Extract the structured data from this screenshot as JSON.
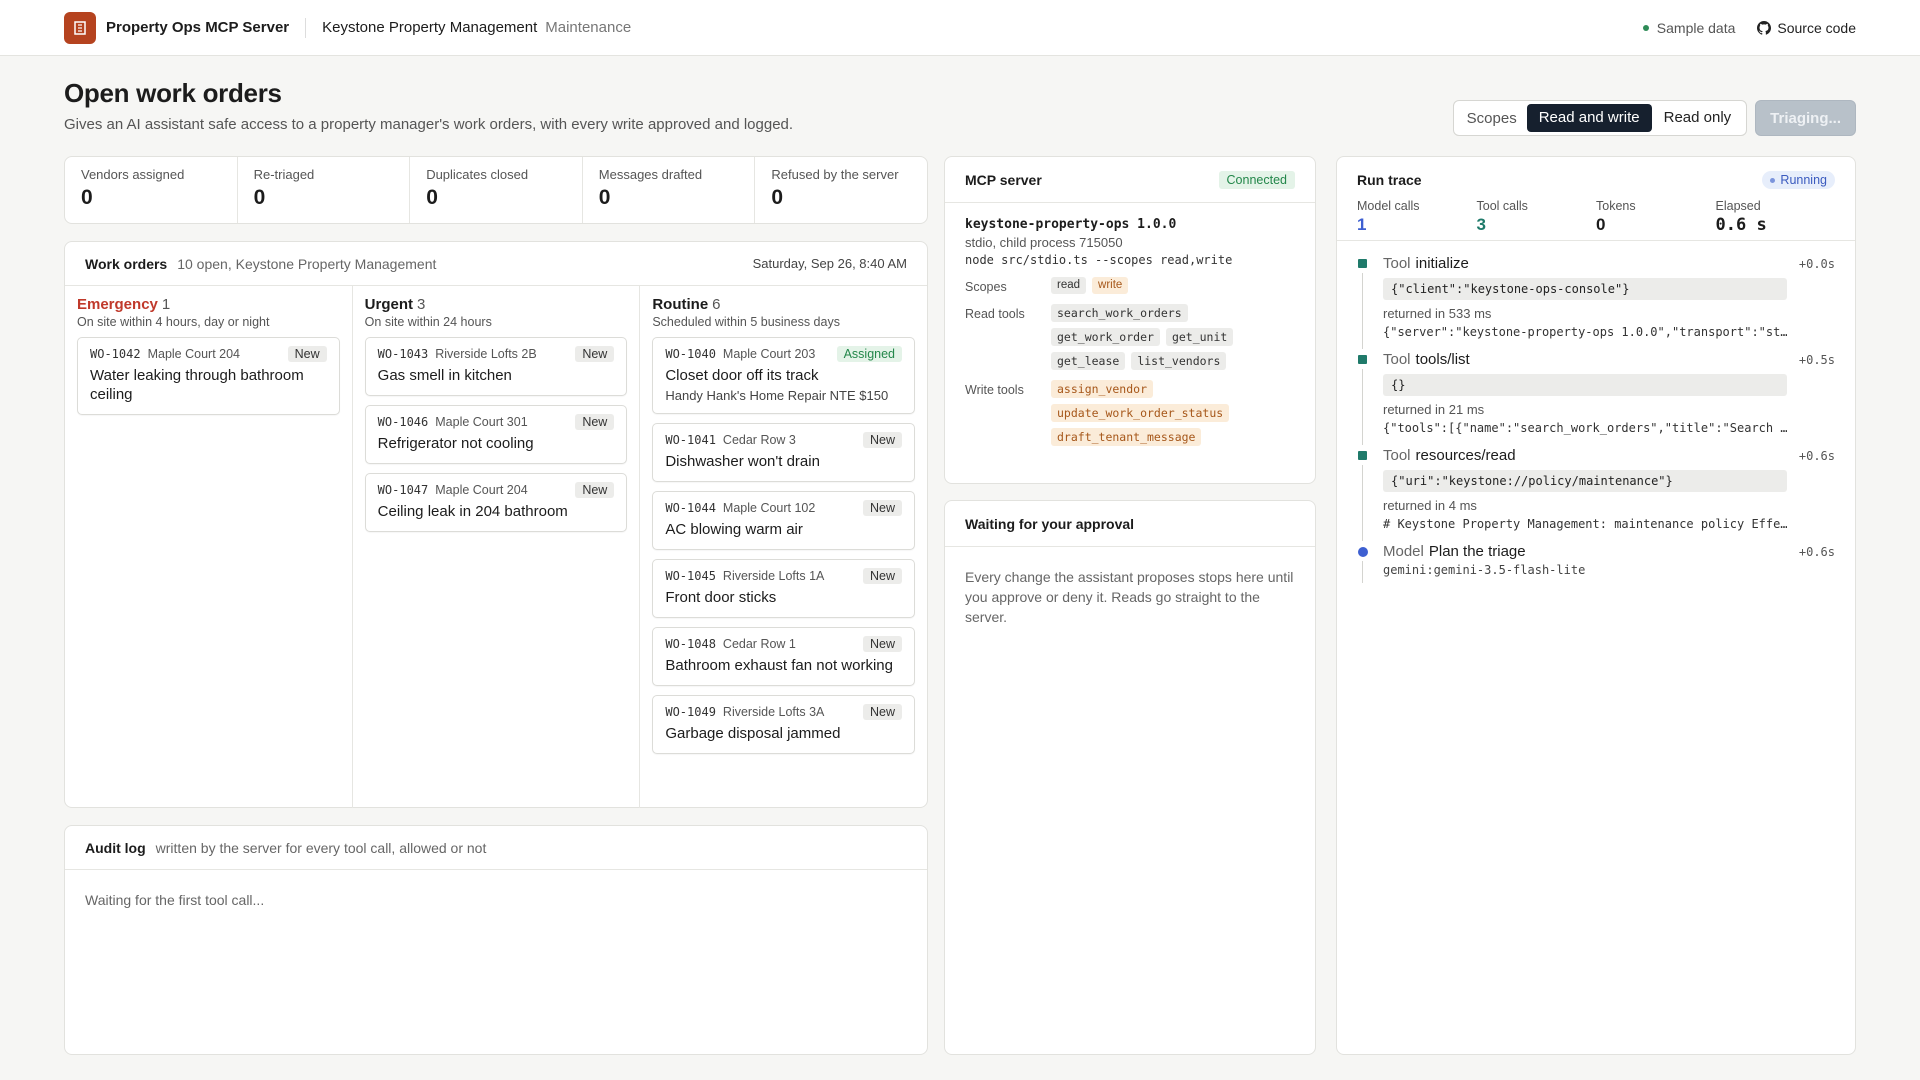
{
  "header": {
    "brand": "Property Ops MCP Server",
    "org": "Keystone Property Management",
    "org_sub": "Maintenance",
    "sample_data": "Sample data",
    "source_code": "Source code"
  },
  "page": {
    "title": "Open work orders",
    "subtitle": "Gives an AI assistant safe access to a property manager's work orders, with every write approved and logged."
  },
  "controls": {
    "scopes_label": "Scopes",
    "read_write": "Read and write",
    "read_only": "Read only",
    "triage_button": "Triaging..."
  },
  "stats": [
    {
      "label": "Vendors assigned",
      "value": "0"
    },
    {
      "label": "Re-triaged",
      "value": "0"
    },
    {
      "label": "Duplicates closed",
      "value": "0"
    },
    {
      "label": "Messages drafted",
      "value": "0"
    },
    {
      "label": "Refused by the server",
      "value": "0"
    }
  ],
  "work_orders": {
    "title": "Work orders",
    "summary": "10 open, Keystone Property Management",
    "date": "Saturday, Sep 26, 8:40 AM",
    "columns": [
      {
        "name": "Emergency",
        "count": "1",
        "sub": "On site within 4 hours, day or night",
        "cards": [
          {
            "id": "WO-1042",
            "loc": "Maple Court 204",
            "badge": "New",
            "title": "Water leaking through bathroom ceiling"
          }
        ]
      },
      {
        "name": "Urgent",
        "count": "3",
        "sub": "On site within 24 hours",
        "cards": [
          {
            "id": "WO-1043",
            "loc": "Riverside Lofts 2B",
            "badge": "New",
            "title": "Gas smell in kitchen"
          },
          {
            "id": "WO-1046",
            "loc": "Maple Court 301",
            "badge": "New",
            "title": "Refrigerator not cooling"
          },
          {
            "id": "WO-1047",
            "loc": "Maple Court 204",
            "badge": "New",
            "title": "Ceiling leak in 204 bathroom"
          }
        ]
      },
      {
        "name": "Routine",
        "count": "6",
        "sub": "Scheduled within 5 business days",
        "cards": [
          {
            "id": "WO-1040",
            "loc": "Maple Court 203",
            "badge": "Assigned",
            "title": "Closet door off its track",
            "note": "Handy Hank's Home Repair NTE $150"
          },
          {
            "id": "WO-1041",
            "loc": "Cedar Row 3",
            "badge": "New",
            "title": "Dishwasher won't drain"
          },
          {
            "id": "WO-1044",
            "loc": "Maple Court 102",
            "badge": "New",
            "title": "AC blowing warm air"
          },
          {
            "id": "WO-1045",
            "loc": "Riverside Lofts 1A",
            "badge": "New",
            "title": "Front door sticks"
          },
          {
            "id": "WO-1048",
            "loc": "Cedar Row 1",
            "badge": "New",
            "title": "Bathroom exhaust fan not working"
          },
          {
            "id": "WO-1049",
            "loc": "Riverside Lofts 3A",
            "badge": "New",
            "title": "Garbage disposal jammed"
          }
        ]
      }
    ]
  },
  "audit": {
    "title": "Audit log",
    "subtitle": "written by the server for every tool call, allowed or not",
    "empty": "Waiting for the first tool call..."
  },
  "mcp": {
    "title": "MCP server",
    "status": "Connected",
    "name": "keystone-property-ops 1.0.0",
    "process": "stdio, child process 715050",
    "command": "node src/stdio.ts --scopes read,write",
    "scopes_label": "Scopes",
    "scopes": [
      "read",
      "write"
    ],
    "read_tools_label": "Read tools",
    "read_tools": [
      "search_work_orders",
      "get_work_order",
      "get_unit",
      "get_lease",
      "list_vendors"
    ],
    "write_tools_label": "Write tools",
    "write_tools": [
      "assign_vendor",
      "update_work_order_status",
      "draft_tenant_message"
    ]
  },
  "approval": {
    "title": "Waiting for your approval",
    "body": "Every change the assistant proposes stops here until you approve or deny it. Reads go straight to the server."
  },
  "trace": {
    "title": "Run trace",
    "status": "Running",
    "stats": [
      {
        "label": "Model calls",
        "value": "1"
      },
      {
        "label": "Tool calls",
        "value": "3"
      },
      {
        "label": "Tokens",
        "value": "0"
      },
      {
        "label": "Elapsed",
        "value": "0.6 s"
      }
    ],
    "events": [
      {
        "kind": "Tool",
        "name": "initialize",
        "time": "+0.0s",
        "args": "{\"client\":\"keystone-ops-console\"}",
        "returned": "returned in 533 ms",
        "output": "{\"server\":\"keystone-property-ops 1.0.0\",\"transport\":\"st…"
      },
      {
        "kind": "Tool",
        "name": "tools/list",
        "time": "+0.5s",
        "args": "{}",
        "returned": "returned in 21 ms",
        "output": "{\"tools\":[{\"name\":\"search_work_orders\",\"title\":\"Search …"
      },
      {
        "kind": "Tool",
        "name": "resources/read",
        "time": "+0.6s",
        "args": "{\"uri\":\"keystone://policy/maintenance\"}",
        "returned": "returned in 4 ms",
        "output": "# Keystone Property Management: maintenance policy Effe…"
      },
      {
        "kind": "Model",
        "name": "Plan the triage",
        "time": "+0.6s",
        "sub": "gemini:gemini-3.5-flash-lite"
      }
    ]
  }
}
